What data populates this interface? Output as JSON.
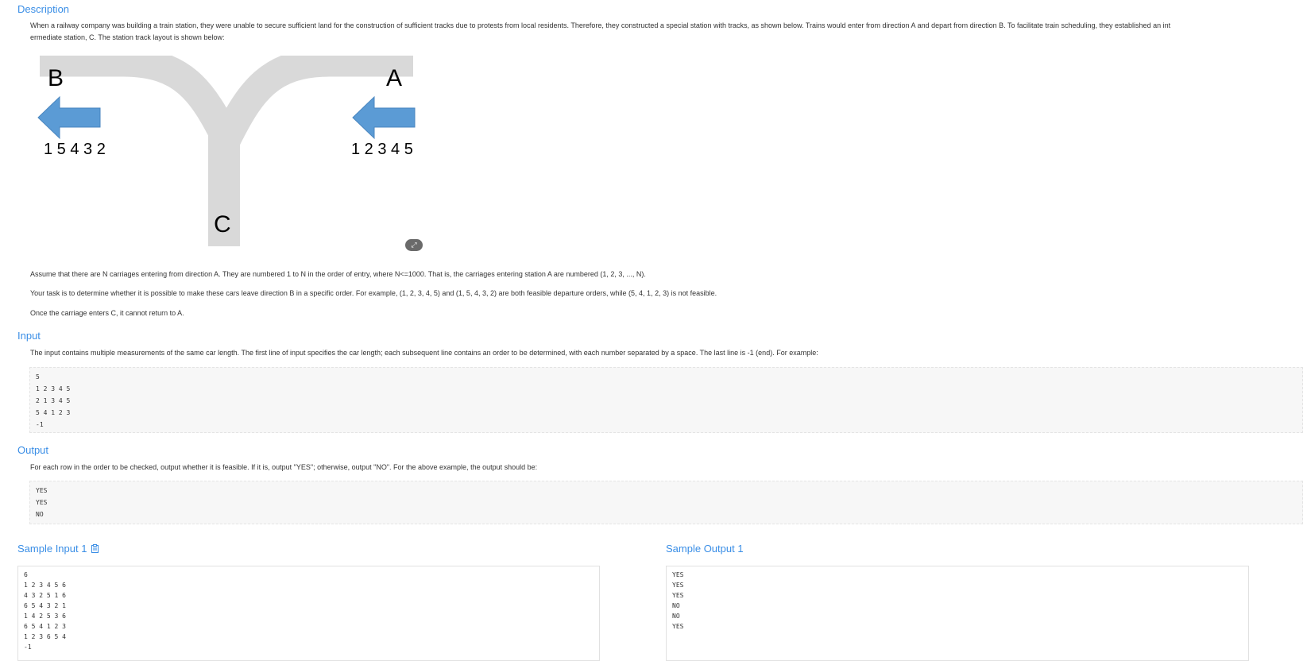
{
  "description": {
    "heading": "Description",
    "para1_line1": "When a railway company was building a train station, they were unable to secure sufficient land for the construction of sufficient tracks due to protests from local residents. Therefore, they constructed a special station with tracks, as shown below. Trains would enter from direction A and depart from direction B. To facilitate train scheduling, they established an int",
    "para1_line2": "ermediate station, C. The station track layout is shown below:",
    "para2": "Assume that there are N carriages entering from direction A. They are numbered 1 to N in the order of entry, where N<=1000. That is, the carriages entering station A are numbered (1, 2, 3, ..., N).",
    "para3": "Your task is to determine whether it is possible to make these cars leave direction B in a specific order. For example, (1, 2, 3, 4, 5) and (1, 5, 4, 3, 2) are both feasible departure orders, while (5, 4, 1, 2, 3) is not feasible.",
    "para4": "Once the carriage enters C, it cannot return to A."
  },
  "diagram": {
    "label_b": "B",
    "label_a": "A",
    "label_c": "C",
    "seq_b": "1 5 4 3 2",
    "seq_a": "1 2 3 4 5",
    "track_color": "#d9d9d9",
    "arrow_color": "#5b9bd5",
    "zoom_icon": "zoom-icon"
  },
  "input": {
    "heading": "Input",
    "text": "The input contains multiple measurements of the same car length. The first line of input specifies the car length; each subsequent line contains an order to be determined, with each number separated by a space. The last line is -1 (end). For example:",
    "example": "5\n1 2 3 4 5\n2 1 3 4 5\n5 4 1 2 3\n-1"
  },
  "output": {
    "heading": "Output",
    "text": "For each row in the order to be checked, output whether it is feasible. If it is, output \"YES\"; otherwise, output \"NO\". For the above example, the output should be:",
    "example": "YES\nYES\nNO"
  },
  "sample_input": {
    "heading": "Sample Input 1",
    "copy_icon": "copy-icon",
    "content": "6\n1 2 3 4 5 6\n4 3 2 5 1 6\n6 5 4 3 2 1\n1 4 2 5 3 6\n6 5 4 1 2 3\n1 2 3 6 5 4\n-1"
  },
  "sample_output": {
    "heading": "Sample Output 1",
    "content": "YES\nYES\nYES\nNO\nNO\nYES"
  },
  "colors": {
    "heading": "#3a8ee6",
    "text": "#333333",
    "code_bg": "#f7f7f7"
  }
}
